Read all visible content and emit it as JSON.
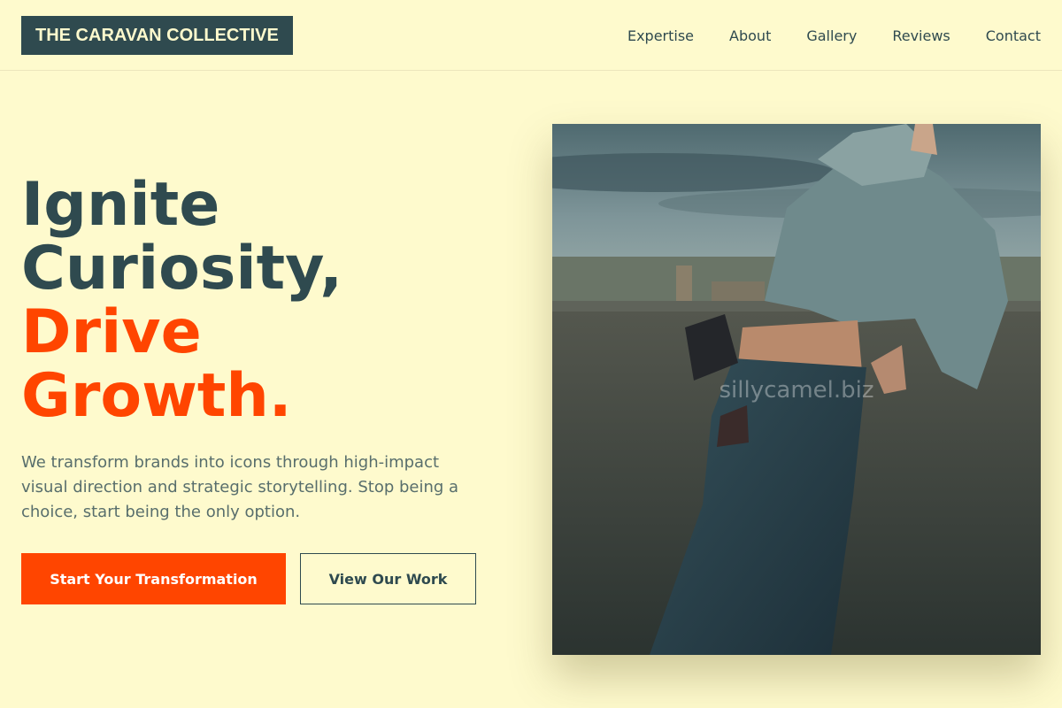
{
  "header": {
    "logo": "THE CARAVAN COLLECTIVE",
    "nav": [
      "Expertise",
      "About",
      "Gallery",
      "Reviews",
      "Contact"
    ]
  },
  "hero": {
    "title_lines": [
      "Ignite",
      "Curiosity,"
    ],
    "title_accent_lines": [
      "Drive",
      "Growth."
    ],
    "description": "We transform brands into icons through high-impact visual direction and strategic storytelling. Stop being a choice, start being the only option.",
    "primary_button": "Start Your Transformation",
    "secondary_button": "View Our Work"
  },
  "image": {
    "watermark": "sillycamel.biz"
  },
  "colors": {
    "background": "#fefacd",
    "primary_dark": "#2f4a4f",
    "accent": "#ff4500"
  }
}
